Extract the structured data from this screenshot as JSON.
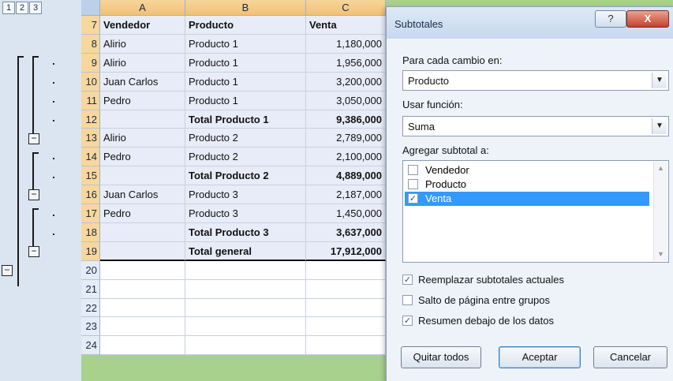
{
  "outline": {
    "levels": [
      "1",
      "2",
      "3"
    ],
    "minus": "−"
  },
  "grid": {
    "columns": [
      "A",
      "B",
      "C"
    ],
    "rows": [
      {
        "num": "7",
        "a": "Vendedor",
        "b": "Producto",
        "c": "Venta",
        "header": true
      },
      {
        "num": "8",
        "a": "Alirio",
        "b": "Producto 1",
        "c": "1,180,000"
      },
      {
        "num": "9",
        "a": "Alirio",
        "b": "Producto 1",
        "c": "1,956,000"
      },
      {
        "num": "10",
        "a": "Juan Carlos",
        "b": "Producto 1",
        "c": "3,200,000"
      },
      {
        "num": "11",
        "a": "Pedro",
        "b": "Producto 1",
        "c": "3,050,000"
      },
      {
        "num": "12",
        "a": "",
        "b": "Total  Producto 1",
        "c": "9,386,000",
        "total": true
      },
      {
        "num": "13",
        "a": "Alirio",
        "b": "Producto 2",
        "c": "2,789,000"
      },
      {
        "num": "14",
        "a": "Pedro",
        "b": "Producto 2",
        "c": "2,100,000"
      },
      {
        "num": "15",
        "a": "",
        "b": "Total  Producto 2",
        "c": "4,889,000",
        "total": true
      },
      {
        "num": "16",
        "a": "Juan Carlos",
        "b": "Producto 3",
        "c": "2,187,000"
      },
      {
        "num": "17",
        "a": "Pedro",
        "b": "Producto 3",
        "c": "1,450,000"
      },
      {
        "num": "18",
        "a": "",
        "b": "Total  Producto 3",
        "c": "3,637,000",
        "total": true
      },
      {
        "num": "19",
        "a": "",
        "b": "Total general",
        "c": "17,912,000",
        "total": true
      },
      {
        "num": "20",
        "a": "",
        "b": "",
        "c": ""
      },
      {
        "num": "21",
        "a": "",
        "b": "",
        "c": ""
      },
      {
        "num": "22",
        "a": "",
        "b": "",
        "c": ""
      },
      {
        "num": "23",
        "a": "",
        "b": "",
        "c": ""
      },
      {
        "num": "24",
        "a": "",
        "b": "",
        "c": ""
      }
    ]
  },
  "dialog": {
    "title": "Subtotales",
    "help": "?",
    "close": "X",
    "group_by_label": "Para cada cambio en:",
    "group_by_value": "Producto",
    "function_label": "Usar función:",
    "function_value": "Suma",
    "add_subtotal_label": "Agregar subtotal a:",
    "columns": [
      {
        "label": "Vendedor",
        "checked": false
      },
      {
        "label": "Producto",
        "checked": false
      },
      {
        "label": "Venta",
        "checked": true
      }
    ],
    "options": [
      {
        "label": "Reemplazar subtotales actuales",
        "checked": true
      },
      {
        "label": "Salto de página entre grupos",
        "checked": false
      },
      {
        "label": "Resumen debajo de los datos",
        "checked": true
      }
    ],
    "buttons": {
      "remove_all": "Quitar todos",
      "ok": "Aceptar",
      "cancel": "Cancelar"
    },
    "check_mark": "✓",
    "arrow": "▼",
    "scroll_up": "▲",
    "scroll_down": "▼"
  }
}
